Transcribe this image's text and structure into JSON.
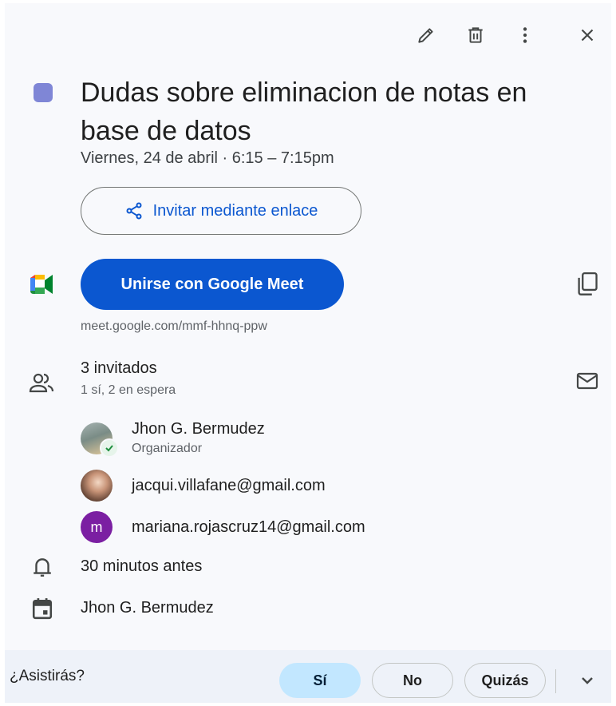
{
  "toolbar": {
    "edit_icon": "pencil-icon",
    "delete_icon": "trash-icon",
    "more_icon": "more-vert-icon",
    "close_icon": "close-icon"
  },
  "event": {
    "color": "#7f86d6",
    "title": "Dudas sobre eliminacion de notas en base de datos",
    "datetime": "Viernes, 24 de abril · 6:15 – 7:15pm"
  },
  "invite_link": {
    "label": "Invitar mediante enlace"
  },
  "meet": {
    "button_label": "Unirse con Google Meet",
    "link": "meet.google.com/mmf-hhnq-ppw"
  },
  "guests": {
    "count_label": "3 invitados",
    "status_label": "1 sí, 2 en espera",
    "list": [
      {
        "name": "Jhon G. Bermudez",
        "role": "Organizador"
      },
      {
        "name": "jacqui.villafane@gmail.com"
      },
      {
        "name": "mariana.rojascruz14@gmail.com",
        "initial": "m"
      }
    ]
  },
  "reminder": {
    "label": "30 minutos antes"
  },
  "calendar": {
    "owner": "Jhon G. Bermudez"
  },
  "footer": {
    "question": "¿Asistirás?",
    "yes": "Sí",
    "no": "No",
    "maybe": "Quizás"
  },
  "colors": {
    "accent": "#0b57d0",
    "selected_rsvp": "#c2e7ff",
    "avatar_purple": "#7b1fa2"
  }
}
